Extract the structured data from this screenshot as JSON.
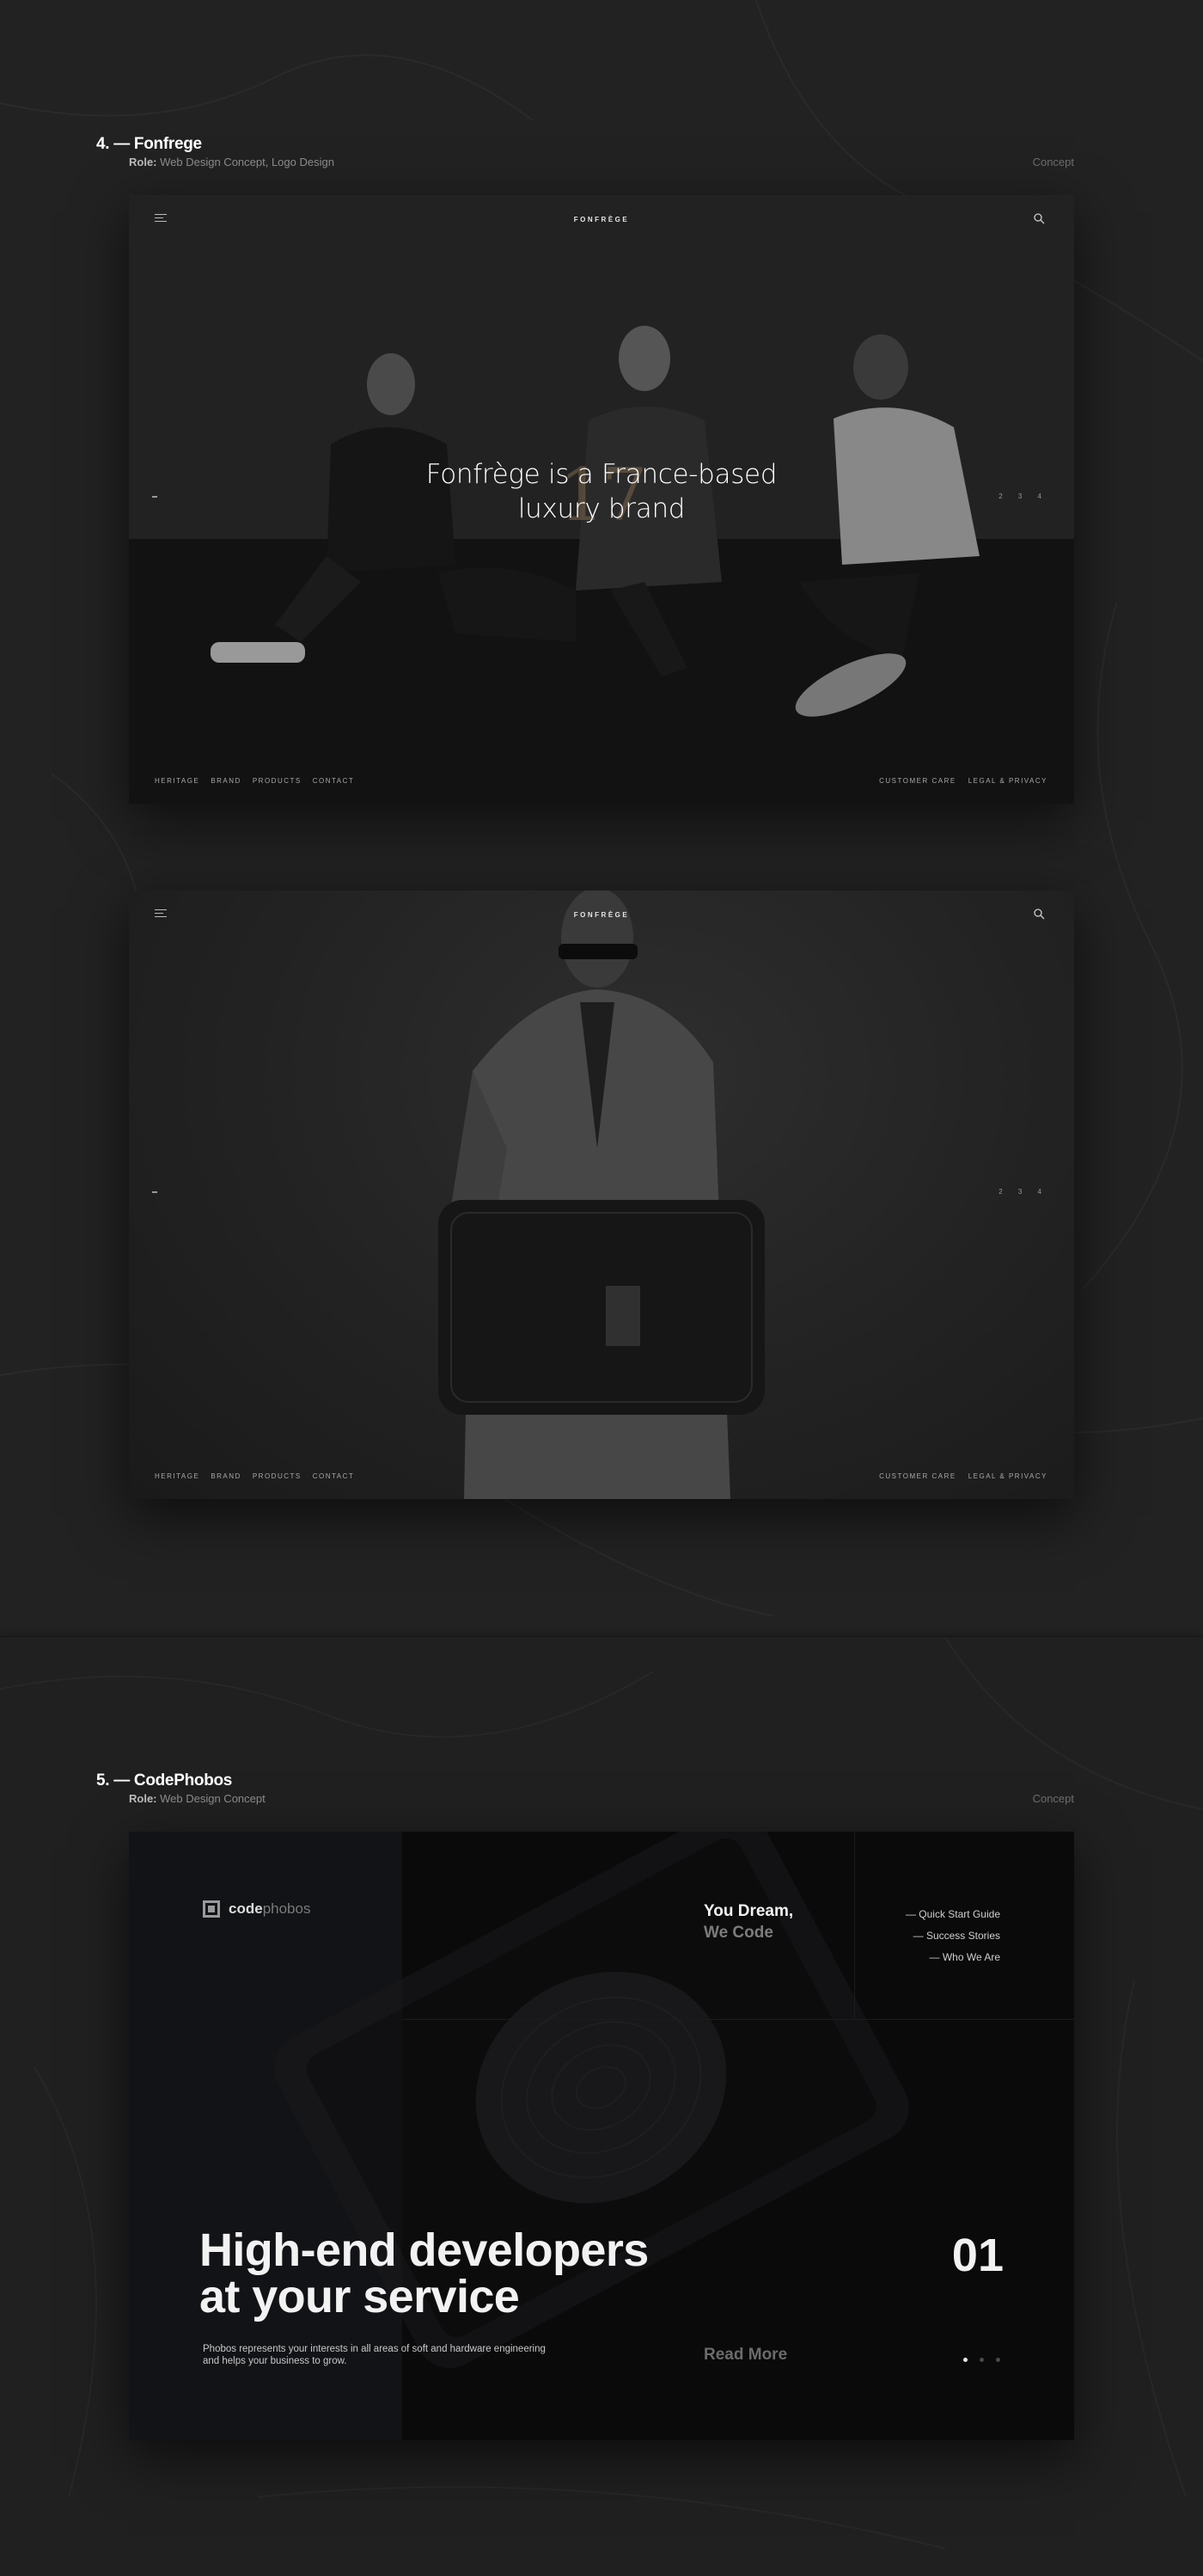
{
  "project4": {
    "title": "4. — Fonfrege",
    "role_label": "Role:",
    "role_value": "Web Design Concept, Logo Design",
    "kind": "Concept",
    "mockup1": {
      "brand": "FONFRÈGE",
      "hero_year": "17",
      "hero_line1": "Fonfrège is a France-based",
      "hero_line2": "luxury brand",
      "side_right": "2 3 4",
      "nav": [
        "HERITAGE",
        "BRAND",
        "PRODUCTS",
        "CONTACT"
      ],
      "nav_right": [
        "CUSTOMER CARE",
        "LEGAL & PRIVACY"
      ]
    },
    "mockup2": {
      "brand": "FONFRÈGE",
      "side_right": "2 3 4",
      "nav": [
        "HERITAGE",
        "BRAND",
        "PRODUCTS",
        "CONTACT"
      ],
      "nav_right": [
        "CUSTOMER CARE",
        "LEGAL & PRIVACY"
      ]
    }
  },
  "project5": {
    "title": "5. — CodePhobos",
    "role_label": "Role:",
    "role_value": "Web Design Concept",
    "kind": "Concept",
    "site": {
      "logo_bold": "code",
      "logo_light": "phobos",
      "dream_line1": "You Dream,",
      "dream_line2": "We Code",
      "links": [
        "— Quick Start Guide",
        "— Success Stories",
        "— Who We Are"
      ],
      "headline_line1": "High-end developers",
      "headline_line2": "at your service",
      "sub_line1": "Phobos represents your interests in all areas of soft and hardware engineering",
      "sub_line2": "and helps your business to grow.",
      "slide_number": "01",
      "read_more": "Read More",
      "active_slide": 1,
      "slide_count": 3
    }
  },
  "colors": {
    "background": "#232323",
    "panel": "#121316",
    "accent_gold": "#a0825a"
  }
}
